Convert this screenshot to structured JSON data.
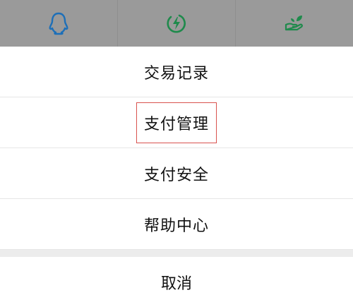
{
  "icons": [
    {
      "name": "qq-penguin-icon",
      "color": "#1d6fb8"
    },
    {
      "name": "lightning-circle-icon",
      "color": "#1f8a4c"
    },
    {
      "name": "hand-leaf-icon",
      "color": "#1f8a4c"
    }
  ],
  "menu": {
    "items": [
      {
        "label": "交易记录"
      },
      {
        "label": "支付管理"
      },
      {
        "label": "支付安全"
      },
      {
        "label": "帮助中心"
      }
    ],
    "cancel_label": "取消"
  },
  "highlight_color": "#d9534f"
}
